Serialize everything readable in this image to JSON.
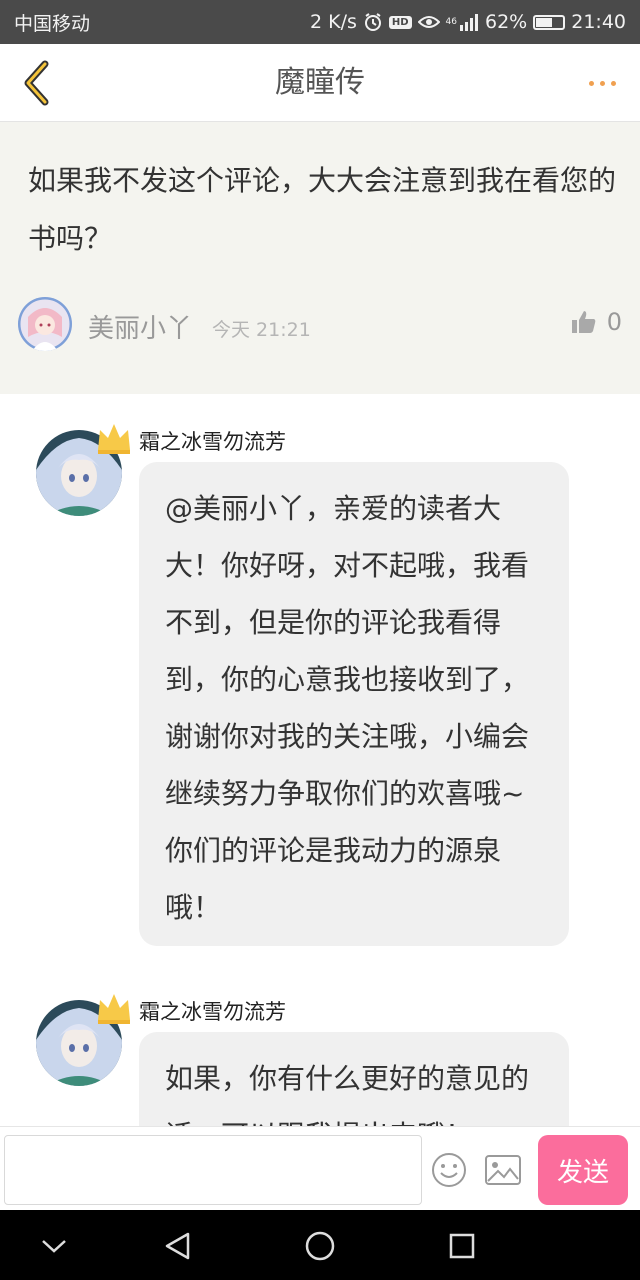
{
  "status_bar": {
    "carrier": "中国移动",
    "net_speed": "2 K/s",
    "hd": "HD",
    "signal": "46",
    "battery": "62%",
    "battery_level": 0.62,
    "time": "21:40"
  },
  "header": {
    "title": "魔瞳传",
    "back_icon": "chevron-left-icon",
    "more_icon": "more-dots-icon",
    "accent_color": "#f0a050"
  },
  "comment": {
    "text": "如果我不发这个评论，大大会注意到我在看您的书吗？",
    "author": "美丽小丫",
    "time": "今天 21:21",
    "likes": "0"
  },
  "replies": [
    {
      "author": "霜之冰雪勿流芳",
      "text": "@美丽小丫，亲爱的读者大大！你好呀，对不起哦，我看不到，但是你的评论我看得到，你的心意我也接收到了，谢谢你对我的关注哦，小编会继续努力争取你们的欢喜哦~你们的评论是我动力的源泉哦！"
    },
    {
      "author": "霜之冰雪勿流芳",
      "text": "如果，你有什么更好的意见的话，可以跟我提出来哦！"
    }
  ],
  "input_bar": {
    "placeholder": "",
    "send_label": "发送",
    "send_color": "#fb6d9c"
  }
}
